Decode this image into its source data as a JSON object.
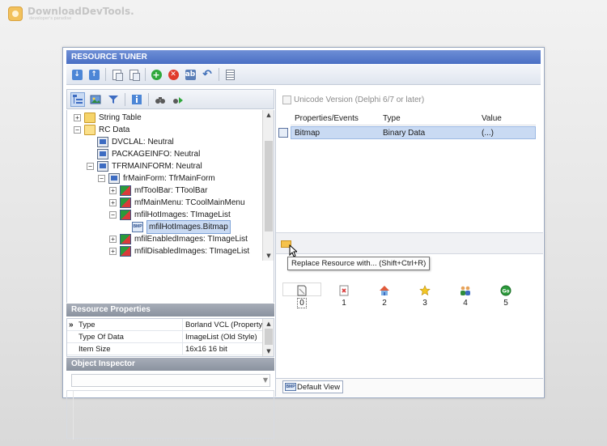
{
  "watermark": {
    "title": "DownloadDevTools.",
    "subtitle": "developer's paradise"
  },
  "window": {
    "title": "RESOURCE TUNER"
  },
  "toolbar": {
    "icons": [
      "arrow-down-icon",
      "arrow-up-icon",
      "copy-icon",
      "paste-icon",
      "add-icon",
      "delete-icon",
      "rename-icon",
      "undo-icon",
      "properties-icon"
    ]
  },
  "left_toolbar": {
    "icons": [
      "tree-view-icon",
      "image-icon",
      "filter-icon",
      "info-icon",
      "find-icon",
      "find-next-icon"
    ]
  },
  "tree": {
    "items": [
      {
        "label": "String Table",
        "expander": "+",
        "icon": "folder-icon",
        "selected": false
      },
      {
        "label": "RC Data",
        "expander": "−",
        "icon": "folder-open-icon",
        "selected": false
      },
      {
        "label": "DVCLAL: Neutral",
        "expander": "",
        "icon": "resource-icon",
        "selected": false
      },
      {
        "label": "PACKAGEINFO: Neutral",
        "expander": "",
        "icon": "package-icon",
        "selected": false
      },
      {
        "label": "TFRMAINFORM: Neutral",
        "expander": "−",
        "icon": "form-icon",
        "selected": false
      },
      {
        "label": "frMainForm: TfrMainForm",
        "expander": "−",
        "icon": "form-icon",
        "selected": false
      },
      {
        "label": "mfToolBar: TToolBar",
        "expander": "+",
        "icon": "component-icon",
        "selected": false
      },
      {
        "label": "mfMainMenu: TCoolMainMenu",
        "expander": "+",
        "icon": "component-icon",
        "selected": false
      },
      {
        "label": "mfilHotImages: TImageList",
        "expander": "−",
        "icon": "component-icon",
        "selected": false
      },
      {
        "label": "mfilHotImages.Bitmap",
        "expander": "",
        "icon": "bitmap-icon",
        "selected": true
      },
      {
        "label": "mfilEnabledImages: TImageList",
        "expander": "+",
        "icon": "component-icon",
        "selected": false
      },
      {
        "label": "mfilDisabledImages: TImageList",
        "expander": "+",
        "icon": "component-icon",
        "selected": false
      }
    ]
  },
  "resource_properties": {
    "header": "Resource Properties",
    "rows": [
      {
        "key": "Type",
        "value": "Borland VCL (Property)",
        "current": true
      },
      {
        "key": "Type Of Data",
        "value": "ImageList (Old Style)",
        "current": false
      },
      {
        "key": "Item Size",
        "value": "16x16 16 bit",
        "current": false
      }
    ]
  },
  "object_inspector": {
    "header": "Object Inspector",
    "value": ""
  },
  "right": {
    "unicode_label": "Unicode Version (Delphi 6/7 or later)",
    "unicode_checked": false,
    "table": {
      "columns": [
        "Properties/Events",
        "Type",
        "Value"
      ],
      "rows": [
        {
          "name": "Bitmap",
          "type": "Binary Data",
          "value": "(...)"
        }
      ]
    },
    "tooltip": "Replace Resource with... (Shift+Ctrl+R)",
    "images": [
      {
        "index": "0",
        "icon": "blank-page-icon"
      },
      {
        "index": "1",
        "icon": "broken-image-icon"
      },
      {
        "index": "2",
        "icon": "home-icon"
      },
      {
        "index": "3",
        "icon": "star-icon"
      },
      {
        "index": "4",
        "icon": "users-icon"
      },
      {
        "index": "5",
        "icon": "go-icon"
      }
    ],
    "selected_image": "0",
    "bottom_tab": "Default View"
  },
  "colors": {
    "titlebar": "#4a6fc4",
    "selection": "#c9daf3",
    "panel_header": "#8a929f"
  }
}
